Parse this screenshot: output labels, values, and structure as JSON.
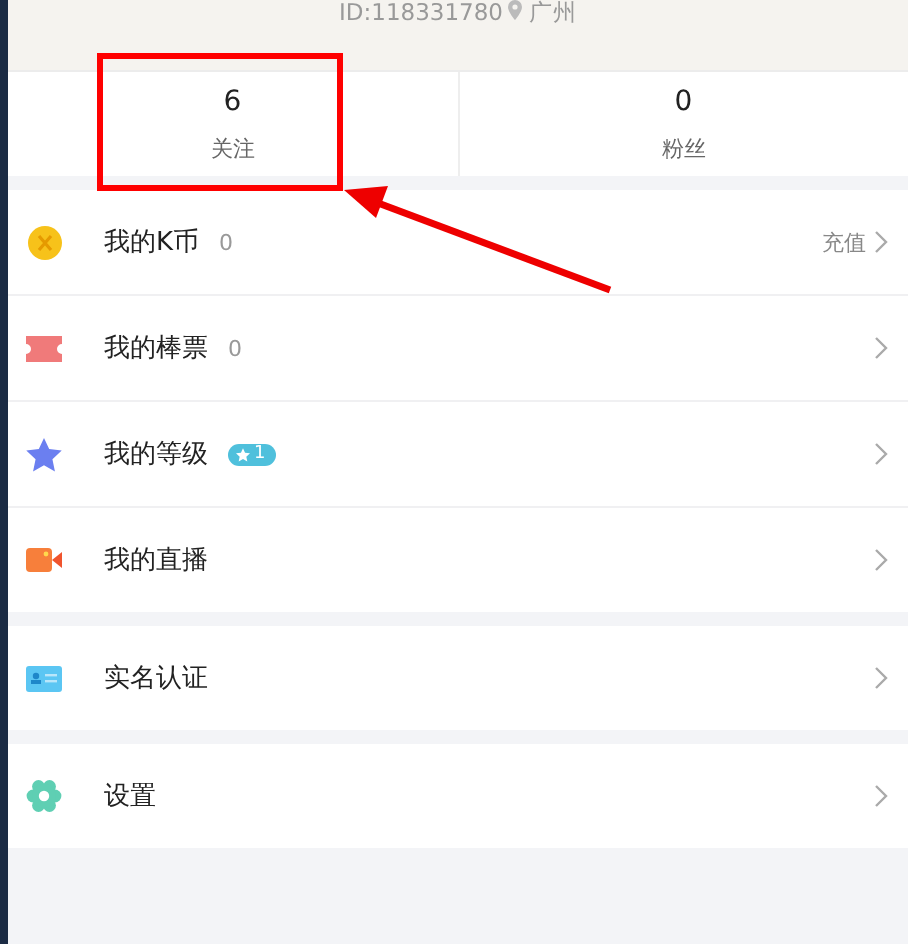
{
  "profile": {
    "id_text": "ID:118331780",
    "location": "广州"
  },
  "stats": [
    {
      "value": "6",
      "label": "关注"
    },
    {
      "value": "0",
      "label": "粉丝"
    }
  ],
  "groups": [
    {
      "items": [
        {
          "kind": "coin",
          "label": "我的K币",
          "count": "0",
          "action": "充值"
        },
        {
          "kind": "ticket",
          "label": "我的棒票",
          "count": "0"
        },
        {
          "kind": "star",
          "label": "我的等级",
          "badge": "1"
        },
        {
          "kind": "camera",
          "label": "我的直播"
        }
      ]
    },
    {
      "items": [
        {
          "kind": "idcard",
          "label": "实名认证"
        }
      ]
    },
    {
      "items": [
        {
          "kind": "gear",
          "label": "设置"
        }
      ]
    }
  ]
}
